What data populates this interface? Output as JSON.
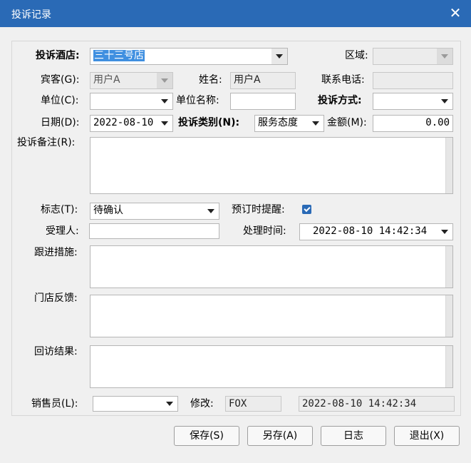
{
  "window": {
    "title": "投诉记录",
    "close_glyph": "✕"
  },
  "hotel": {
    "label": "投诉酒店:",
    "value": "三十三号店"
  },
  "area": {
    "label": "区域:",
    "value": ""
  },
  "guest": {
    "label": "宾客(G):",
    "value": "用户A"
  },
  "name": {
    "label": "姓名:",
    "value": "用户A"
  },
  "phone": {
    "label": "联系电话:",
    "value": ""
  },
  "unit": {
    "label": "单位(C):",
    "value": ""
  },
  "unit_name": {
    "label": "单位名称:",
    "value": ""
  },
  "method": {
    "label": "投诉方式:",
    "value": ""
  },
  "date": {
    "label": "日期(D):",
    "value": "2022-08-10"
  },
  "category": {
    "label": "投诉类别(N):",
    "value": "服务态度"
  },
  "amount": {
    "label": "金额(M):",
    "value": "0.00"
  },
  "remark": {
    "label": "投诉备注(R):",
    "value": ""
  },
  "flag": {
    "label": "标志(T):",
    "value": "待确认"
  },
  "reminder": {
    "label": "预订时提醒:",
    "checked": true
  },
  "handler": {
    "label": "受理人:",
    "value": ""
  },
  "process_time": {
    "label": "处理时间:",
    "value": "2022-08-10 14:42:34"
  },
  "followup": {
    "label": "跟进措施:",
    "value": ""
  },
  "store_feedback": {
    "label": "门店反馈:",
    "value": ""
  },
  "callback_result": {
    "label": "回访结果:",
    "value": ""
  },
  "salesperson": {
    "label": "销售员(L):",
    "value": ""
  },
  "modified": {
    "label": "修改:",
    "user": "FOX",
    "time": "2022-08-10 14:42:34"
  },
  "buttons": {
    "save": "保存(S)",
    "save_as": "另存(A)",
    "log": "日志",
    "exit": "退出(X)"
  },
  "colors": {
    "titlebar": "#2a6ab6",
    "selection": "#3f8fe0",
    "checkbox": "#2a6ab6"
  }
}
